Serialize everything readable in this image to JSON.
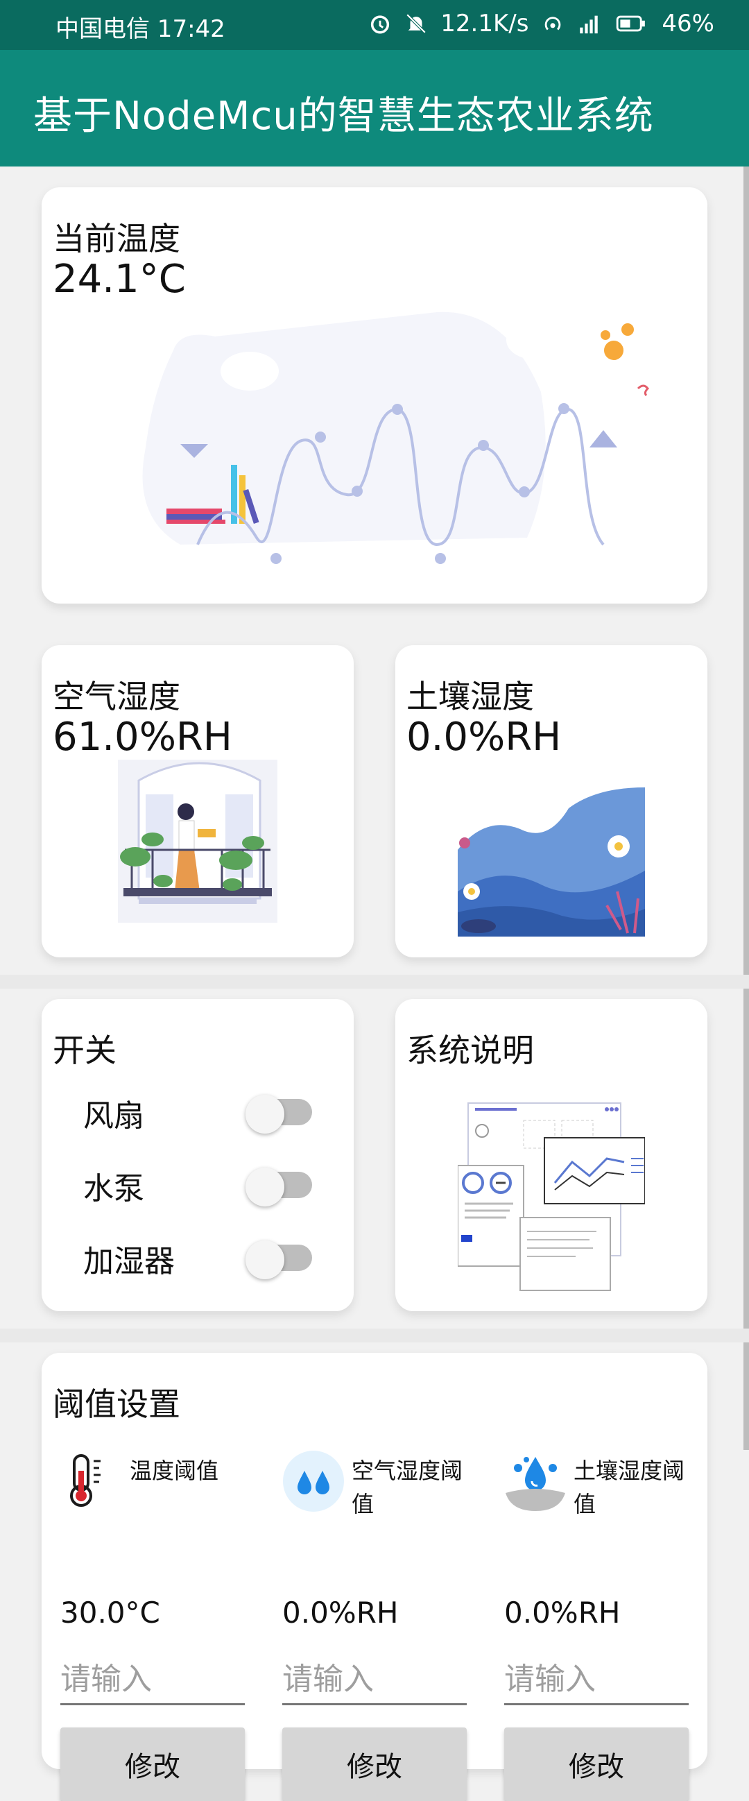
{
  "status_bar": {
    "carrier_time": "中国电信 17:42",
    "network_speed": "12.1K/s",
    "battery": "46%",
    "icons": [
      "alarm-icon",
      "mute-icon",
      "hotspot-icon",
      "signal-icon",
      "battery-icon"
    ]
  },
  "app_bar": {
    "title": "基于NodeMcu的智慧生态农业系统"
  },
  "temperature": {
    "label": "当前温度",
    "value": "24.1°C"
  },
  "air_humidity": {
    "label": "空气湿度",
    "value": "61.0%RH"
  },
  "soil_humidity": {
    "label": "土壤湿度",
    "value": "0.0%RH"
  },
  "switches": {
    "title": "开关",
    "items": [
      {
        "label": "风扇",
        "on": false
      },
      {
        "label": "水泵",
        "on": false
      },
      {
        "label": "加湿器",
        "on": false
      }
    ]
  },
  "description": {
    "title": "系统说明"
  },
  "thresholds": {
    "title": "阈值设置",
    "items": [
      {
        "label": "温度阈值",
        "value": "30.0°C",
        "placeholder": "请输入",
        "button": "修改",
        "icon": "thermometer-icon"
      },
      {
        "label": "空气湿度阈值",
        "value": "0.0%RH",
        "placeholder": "请输入",
        "button": "修改",
        "icon": "water-drops-icon"
      },
      {
        "label": "土壤湿度阈值",
        "value": "0.0%RH",
        "placeholder": "请输入",
        "button": "修改",
        "icon": "soil-moisture-icon"
      }
    ]
  },
  "colors": {
    "status_bar": "#0a6b5f",
    "app_bar": "#0e8a7c",
    "background": "#f1f1f1",
    "card": "#ffffff"
  }
}
